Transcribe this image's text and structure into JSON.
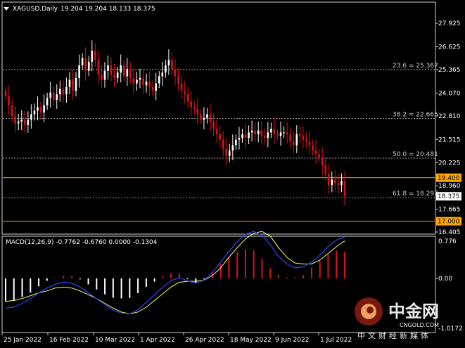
{
  "header": {
    "symbol": "XAGUSD,Daily",
    "ohlc": "19.204 19.204 18.133 18.375"
  },
  "macd": {
    "title": "MACD(12,26,9) -0.7762 -0.6760 0.0000 -0.1304",
    "top_label": "0.776",
    "zero_label": "0.00",
    "bottom_label": "-1.0172"
  },
  "fibo_labels": [
    "23.6 = 25.367",
    "38.2 = 22.665",
    "50.0 = 20.481",
    "61.8 = 18.297"
  ],
  "price_tags": [
    {
      "label": "19.400",
      "color": "#ffa500",
      "text_color": "#000000"
    },
    {
      "label": "18.375",
      "color": "#ffffff",
      "text_color": "#000000"
    },
    {
      "label": "17.000",
      "color": "#ffa500",
      "text_color": "#000000"
    }
  ],
  "watermark": {
    "brand": "中金网",
    "site": "CNGOLD.COM",
    "slogan": "中文财经新媒体"
  },
  "chart_data": {
    "type": "candlestick",
    "symbol": "XAGUSD",
    "timeframe": "Daily",
    "price_axis": {
      "min": 16.405,
      "max": 29.0,
      "ticks": [
        27.925,
        26.625,
        25.365,
        24.07,
        22.81,
        21.515,
        20.225,
        18.96,
        17.665,
        16.405
      ]
    },
    "x_ticks": [
      "25 Jan 2022",
      "16 Feb 2022",
      "10 Mar 2022",
      "1 Apr 2022",
      "26 Apr 2022",
      "18 May 2022",
      "9 Jun 2022",
      "1 Jul 2022"
    ],
    "closes": [
      23.9,
      23.4,
      22.8,
      22.4,
      22.5,
      22.6,
      22.3,
      22.6,
      22.9,
      23.1,
      23.3,
      23.0,
      23.4,
      23.8,
      24.1,
      23.7,
      24.0,
      24.3,
      24.0,
      24.4,
      24.8,
      24.2,
      24.9,
      25.6,
      26.0,
      25.3,
      25.8,
      26.4,
      25.9,
      25.1,
      24.8,
      25.3,
      25.6,
      25.1,
      24.9,
      25.2,
      25.6,
      25.0,
      25.4,
      24.9,
      24.6,
      24.8,
      24.9,
      24.5,
      24.7,
      24.4,
      24.2,
      24.6,
      25.0,
      25.2,
      25.6,
      25.9,
      25.4,
      25.0,
      24.6,
      24.2,
      24.0,
      23.6,
      23.3,
      23.2,
      22.9,
      22.6,
      22.7,
      22.9,
      22.5,
      22.1,
      21.8,
      21.5,
      21.0,
      20.6,
      20.9,
      21.2,
      21.5,
      21.6,
      21.8,
      21.6,
      21.9,
      22.0,
      21.8,
      22.0,
      21.7,
      21.6,
      21.9,
      22.1,
      21.8,
      21.7,
      21.9,
      21.9,
      21.8,
      21.4,
      21.2,
      21.8,
      21.7,
      21.5,
      21.4,
      21.2,
      20.9,
      20.7,
      20.5,
      20.1,
      19.6,
      19.0,
      19.3,
      19.1,
      19.0,
      19.2,
      18.375
    ],
    "fibonacci": [
      {
        "level": "23.6",
        "price": 25.367
      },
      {
        "level": "38.2",
        "price": 22.665
      },
      {
        "level": "50.0",
        "price": 20.481
      },
      {
        "level": "61.8",
        "price": 18.297
      }
    ],
    "horizontal_lines": [
      19.4,
      17.0
    ],
    "macd": {
      "params": [
        12,
        26,
        9
      ],
      "range": [
        -1.0172,
        0.776
      ],
      "main_line": [
        0.62,
        0.6,
        0.52,
        0.42,
        0.3,
        0.2,
        0.12,
        0.08,
        0.1,
        0.18,
        0.3,
        0.42,
        0.55,
        0.66,
        0.72,
        0.74,
        0.65,
        0.5,
        0.34,
        0.18,
        0.05,
        -0.02,
        0.05,
        0.1,
        0.04,
        -0.12,
        -0.34,
        -0.56,
        -0.76,
        -0.92,
        -0.98,
        -0.9,
        -0.7,
        -0.46,
        -0.3,
        -0.22,
        -0.24,
        -0.34,
        -0.48,
        -0.66,
        -0.8,
        -0.86
      ],
      "signal_line": [
        0.48,
        0.46,
        0.42,
        0.36,
        0.3,
        0.26,
        0.2,
        0.18,
        0.2,
        0.26,
        0.34,
        0.42,
        0.52,
        0.62,
        0.7,
        0.74,
        0.7,
        0.6,
        0.46,
        0.32,
        0.18,
        0.08,
        0.06,
        0.06,
        0.04,
        -0.06,
        -0.22,
        -0.44,
        -0.64,
        -0.82,
        -0.94,
        -0.98,
        -0.88,
        -0.64,
        -0.44,
        -0.32,
        -0.3,
        -0.3,
        -0.38,
        -0.52,
        -0.66,
        -0.78
      ]
    }
  }
}
